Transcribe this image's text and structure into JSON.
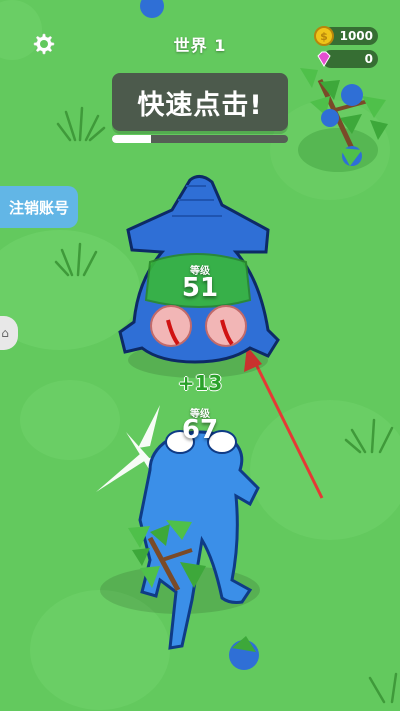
{
  "hud": {
    "world_label": "世界 1",
    "coins": "1000",
    "gems": "0"
  },
  "banner": {
    "text": "快速点击!",
    "progress": 0.22
  },
  "side": {
    "logout_label": "注销账号"
  },
  "enemy": {
    "level_caption": "等级",
    "level": "51"
  },
  "player": {
    "level_caption": "等级",
    "level": "67",
    "gain": "+13"
  },
  "colors": {
    "grass": "#63c95e",
    "enemy_body": "#2f6fd6",
    "player_body": "#3b8fe8",
    "button_blue": "#62b6e6",
    "arrow_red": "#e53935"
  }
}
